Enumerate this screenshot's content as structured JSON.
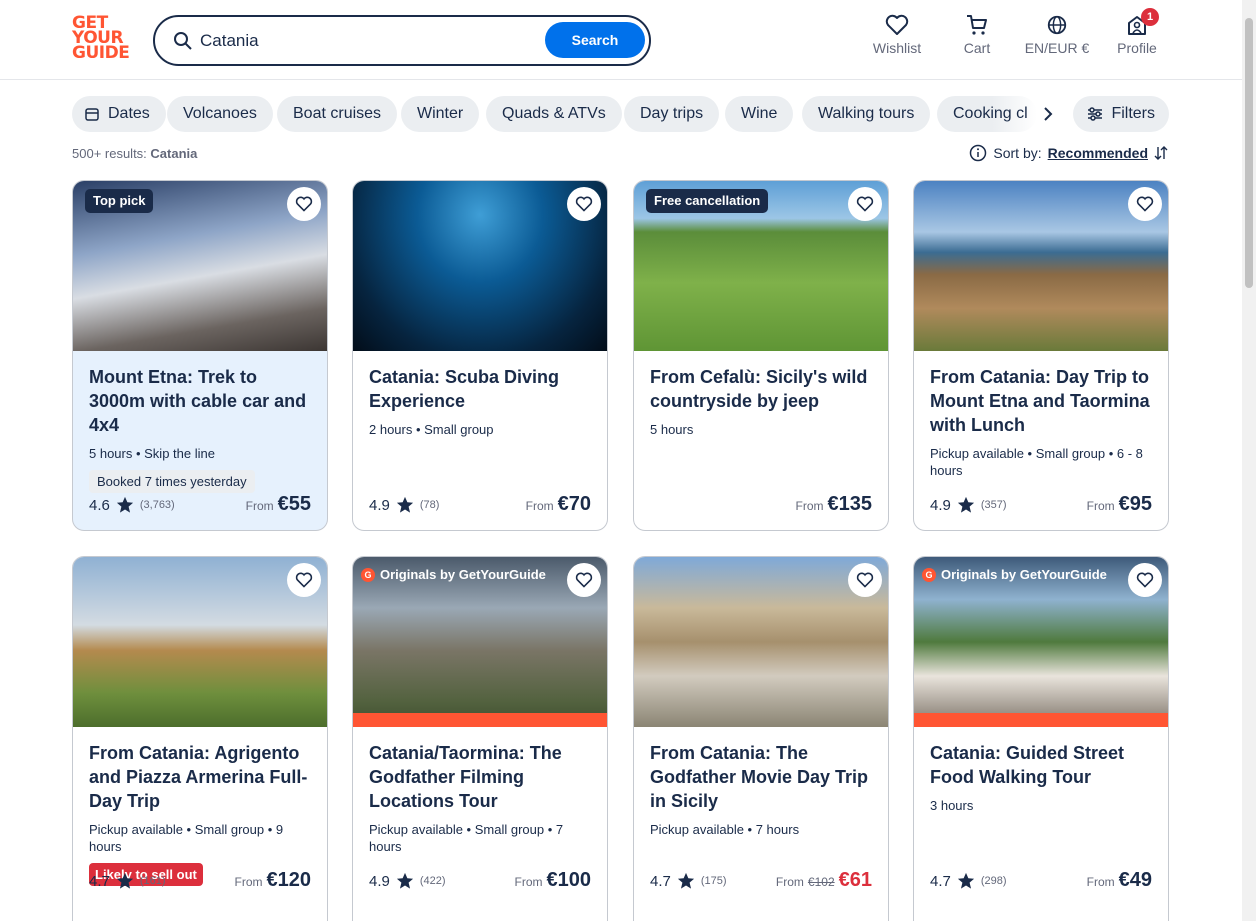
{
  "logo": {
    "line1": "GET",
    "line2": "YOUR",
    "line3": "GUIDE"
  },
  "search": {
    "value": "Catania",
    "button": "Search"
  },
  "nav": {
    "wishlist": "Wishlist",
    "cart": "Cart",
    "language": "EN/EUR €",
    "profile": "Profile",
    "profile_badge": "1"
  },
  "chips": [
    "Dates",
    "Volcanoes",
    "Boat cruises",
    "Winter",
    "Quads & ATVs",
    "Day trips",
    "Wine",
    "Walking tours",
    "Cooking cl"
  ],
  "filters_label": "Filters",
  "results": {
    "count": "500+ results:",
    "query": "Catania"
  },
  "sort": {
    "label": "Sort by:",
    "value": "Recommended"
  },
  "cards": [
    {
      "tag": "Top pick",
      "title": "Mount Etna: Trek to 3000m with cable car and 4x4",
      "meta": "5 hours • Skip the line",
      "extra": "Booked 7 times yesterday",
      "rating": "4.6",
      "count": "(3,763)",
      "from": "From",
      "price": "€55"
    },
    {
      "title": "Catania: Scuba Diving Experience",
      "meta": "2 hours • Small group",
      "rating": "4.9",
      "count": "(78)",
      "from": "From",
      "price": "€70"
    },
    {
      "tag": "Free cancellation",
      "title": "From Cefalù: Sicily's wild countryside by jeep",
      "meta": "5 hours",
      "from": "From",
      "price": "€135"
    },
    {
      "title": "From Catania: Day Trip to Mount Etna and Taormina with Lunch",
      "meta": "Pickup available • Small group • 6 - 8 hours",
      "rating": "4.9",
      "count": "(357)",
      "from": "From",
      "price": "€95"
    },
    {
      "title": "From Catania: Agrigento and Piazza Armerina Full-Day Trip",
      "meta": "Pickup available • Small group • 9 hours",
      "extra": "Likely to sell out",
      "rating": "4.7",
      "count": "(161)",
      "from": "From",
      "price": "€120"
    },
    {
      "orig": "Originals by GetYourGuide",
      "title": "Catania/Taormina: The Godfather Filming Locations Tour",
      "meta": "Pickup available • Small group • 7 hours",
      "rating": "4.9",
      "count": "(422)",
      "from": "From",
      "price": "€100"
    },
    {
      "title": "From Catania: The Godfather Movie Day Trip in Sicily",
      "meta": "Pickup available • 7 hours",
      "rating": "4.7",
      "count": "(175)",
      "from": "From",
      "old_price": "€102",
      "price": "€61"
    },
    {
      "orig": "Originals by GetYourGuide",
      "title": "Catania: Guided Street Food Walking Tour",
      "meta": "3 hours",
      "rating": "4.7",
      "count": "(298)",
      "from": "From",
      "price": "€49"
    }
  ],
  "colors": {
    "brand": "#ff5533",
    "accent": "#0071eb",
    "navy": "#1a2b49",
    "alert": "#dc2f3c"
  }
}
